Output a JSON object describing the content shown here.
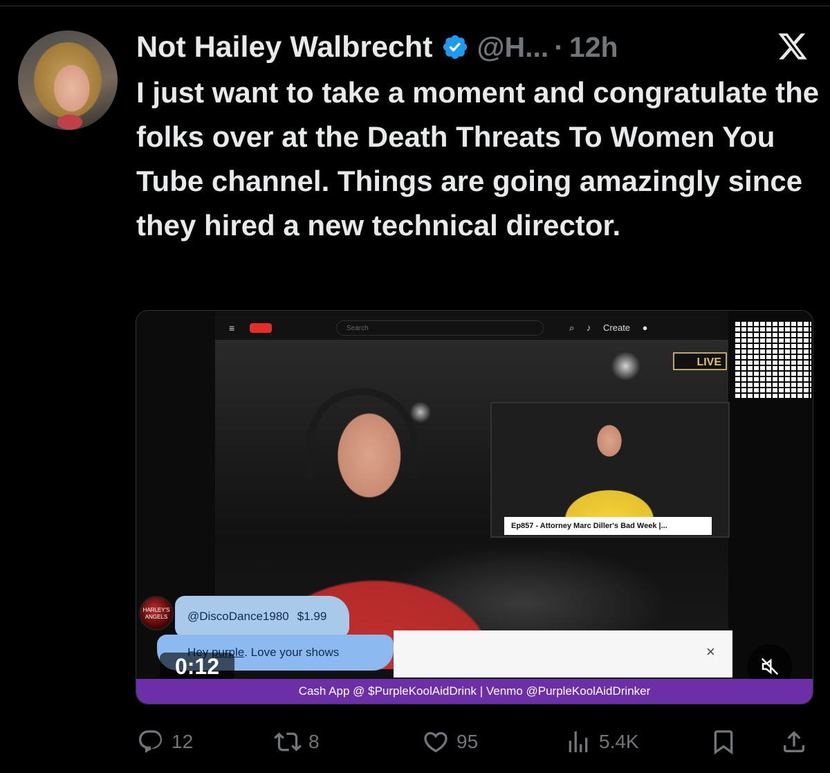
{
  "post": {
    "author_name": "Not Hailey Walbrecht",
    "handle": "@H...",
    "separator": "·",
    "time": "12h",
    "text": "I just want to take a moment and congratulate the folks over at the Death Threats To Women You Tube channel. Things are going amazingly since they hired a new technical director."
  },
  "media": {
    "duration": "0:12",
    "live_badge": "LIVE",
    "youtube_search_placeholder": "Search",
    "youtube_create_label": "Create",
    "inset_caption": "Ep857 - Attorney Marc Diller's Bad Week |...",
    "superchat": {
      "user": "@DiscoDance1980",
      "amount": "$1.99",
      "message_pre": "Hey ",
      "message_link": "purple",
      "message_post": ". Love your shows",
      "avatar_text": "HARLEY'S ANGELS"
    },
    "chat_close": "×",
    "banner": "Cash App @ $PurpleKoolAidDrink | Venmo @PurpleKoolAidDrinker"
  },
  "actions": {
    "replies": "12",
    "reposts": "8",
    "likes": "95",
    "views": "5.4K"
  },
  "colors": {
    "background": "#000000",
    "text": "#e7e9ea",
    "muted": "#71767b",
    "verified": "#1d9bf0",
    "banner": "#6d2fa8"
  },
  "icons": [
    "verified-badge-icon",
    "x-logo-icon",
    "reply-icon",
    "repost-icon",
    "like-icon",
    "views-icon",
    "bookmark-icon",
    "share-icon",
    "mute-icon"
  ]
}
